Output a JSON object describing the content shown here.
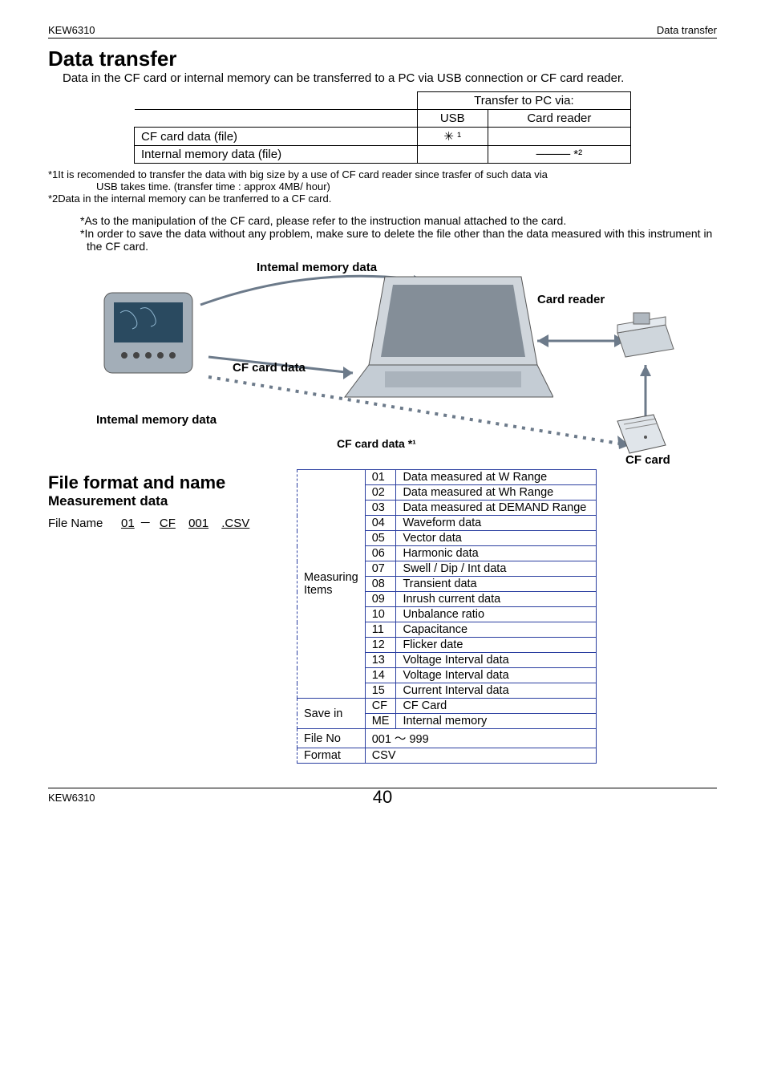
{
  "header": {
    "left": "KEW6310",
    "right": "Data transfer"
  },
  "title": "Data transfer",
  "intro": "Data in the CF card or internal memory can be transferred to a PC via USB connection or CF card reader.",
  "transfer": {
    "headTop": "Transfer to PC via:",
    "col1": "USB",
    "col2": "Card reader",
    "rows": [
      {
        "label": "CF card data (file)",
        "usb": "✳   ¹",
        "reader": ""
      },
      {
        "label": "Internal memory data (file)",
        "usb": "",
        "reader": "──── *²"
      }
    ]
  },
  "note1a": "*1It is recomended to transfer the data with big size by a use of CF card reader since trasfer of such data via",
  "note1b": "USB takes time. (transfer time : approx 4MB/ hour)",
  "note2": "*2Data in the internal memory can be tranferred to a CF card.",
  "noteA": "*As to the manipulation of the CF card, please refer to the instruction manual attached to the card.",
  "noteB": "*In order to save the data without any problem, make sure to delete the file other than the data measured with this instrument in the CF card.",
  "diagram": {
    "intMemTop": "Intemal memory data",
    "cfData": "CF card data",
    "intMemBottom": "Intemal memory data",
    "cfDataBottom": "CF card data *¹",
    "cardReader": "Card reader",
    "cfCard": "CF card"
  },
  "fileFormat": {
    "h2": "File format and name",
    "h3": "Measurement data",
    "fnLabel": "File Name",
    "p1": "01",
    "p2": "CF",
    "p3": "001",
    "p4": ".CSV"
  },
  "mtable": {
    "measLabel": "Measuring Items",
    "rows": [
      [
        "01",
        "Data measured at W Range"
      ],
      [
        "02",
        "Data measured at Wh Range"
      ],
      [
        "03",
        "Data measured at DEMAND Range"
      ],
      [
        "04",
        "Waveform data"
      ],
      [
        "05",
        "Vector data"
      ],
      [
        "06",
        "Harmonic data"
      ],
      [
        "07",
        "Swell / Dip / Int data"
      ],
      [
        "08",
        "Transient data"
      ],
      [
        "09",
        "Inrush current data"
      ],
      [
        "10",
        "Unbalance ratio"
      ],
      [
        "11",
        "Capacitance"
      ],
      [
        "12",
        "Flicker date"
      ],
      [
        "13",
        "Voltage Interval data"
      ],
      [
        "14",
        "Voltage Interval data"
      ],
      [
        "15",
        "Current Interval data"
      ]
    ],
    "saveLabel": "Save in",
    "saveRows": [
      [
        "CF",
        "CF Card"
      ],
      [
        "ME",
        "Internal memory"
      ]
    ],
    "fileNoLabel": "File No",
    "fileNoVal": "001 ～ 999",
    "formatLabel": "Format",
    "formatVal": "CSV"
  },
  "footer": {
    "left": "KEW6310",
    "page": "40"
  }
}
